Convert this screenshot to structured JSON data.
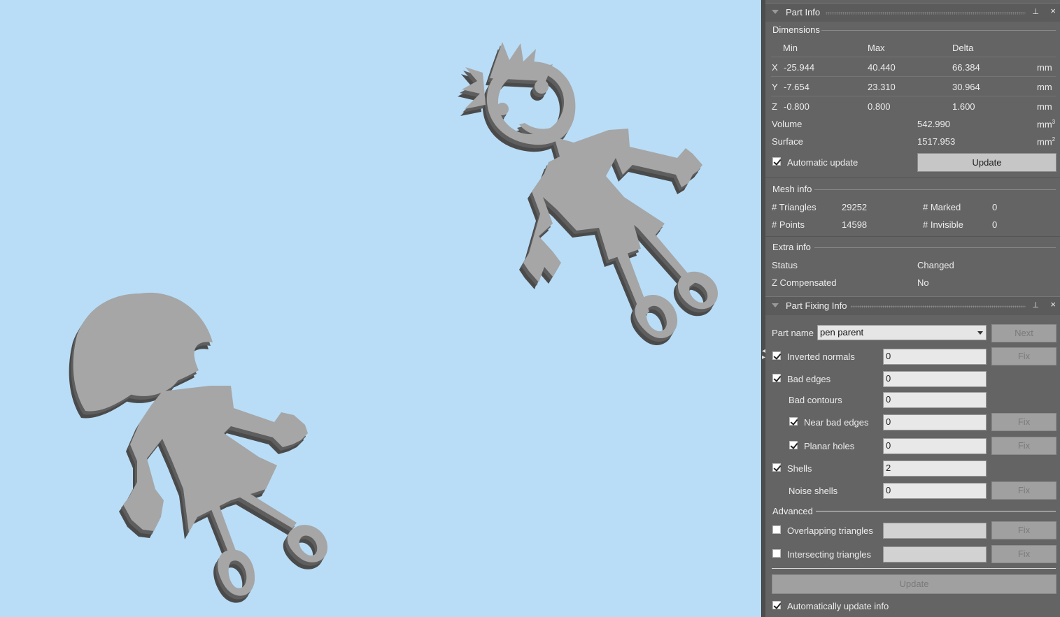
{
  "part_info": {
    "title": "Part Info",
    "dimensions": {
      "label": "Dimensions",
      "headers": {
        "min": "Min",
        "max": "Max",
        "delta": "Delta"
      },
      "rows": [
        {
          "axis": "X",
          "min": "-25.944",
          "max": "40.440",
          "delta": "66.384",
          "unit": "mm"
        },
        {
          "axis": "Y",
          "min": "-7.654",
          "max": "23.310",
          "delta": "30.964",
          "unit": "mm"
        },
        {
          "axis": "Z",
          "min": "-0.800",
          "max": "0.800",
          "delta": "1.600",
          "unit": "mm"
        }
      ],
      "volume_label": "Volume",
      "volume_value": "542.990",
      "volume_unit": "mm",
      "surface_label": "Surface",
      "surface_value": "1517.953",
      "surface_unit": "mm",
      "auto_update_label": "Automatic update",
      "auto_update_checked": true,
      "update_button": "Update"
    },
    "mesh_info": {
      "label": "Mesh info",
      "triangles_label": "# Triangles",
      "triangles_value": "29252",
      "points_label": "# Points",
      "points_value": "14598",
      "marked_label": "# Marked",
      "marked_value": "0",
      "invisible_label": "# Invisible",
      "invisible_value": "0"
    },
    "extra_info": {
      "label": "Extra info",
      "status_label": "Status",
      "status_value": "Changed",
      "zcomp_label": "Z Compensated",
      "zcomp_value": "No"
    }
  },
  "part_fixing": {
    "title": "Part Fixing Info",
    "part_name_label": "Part name",
    "part_name_value": "pen parent",
    "next_button": "Next",
    "fix_label": "Fix",
    "rows": {
      "inverted_normals": {
        "label": "Inverted normals",
        "value": "0",
        "checked": true
      },
      "bad_edges": {
        "label": "Bad edges",
        "value": "0",
        "checked": true
      },
      "bad_contours": {
        "label": "Bad contours",
        "value": "0"
      },
      "near_bad_edges": {
        "label": "Near bad edges",
        "value": "0",
        "checked": true
      },
      "planar_holes": {
        "label": "Planar holes",
        "value": "0",
        "checked": true
      },
      "shells": {
        "label": "Shells",
        "value": "2",
        "checked": true
      },
      "noise_shells": {
        "label": "Noise shells",
        "value": "0"
      }
    },
    "advanced_label": "Advanced",
    "overlapping": {
      "label": "Overlapping triangles",
      "value": "",
      "checked": false
    },
    "intersecting": {
      "label": "Intersecting triangles",
      "value": "",
      "checked": false
    },
    "update_button": "Update",
    "auto_update_info_label": "Automatically update info",
    "auto_update_info_checked": true
  },
  "colors": {
    "viewport_bg": "#b9ddf7",
    "panel_bg": "#646464",
    "part_fill": "#a6a6a6",
    "part_side": "#4a4a4a"
  }
}
